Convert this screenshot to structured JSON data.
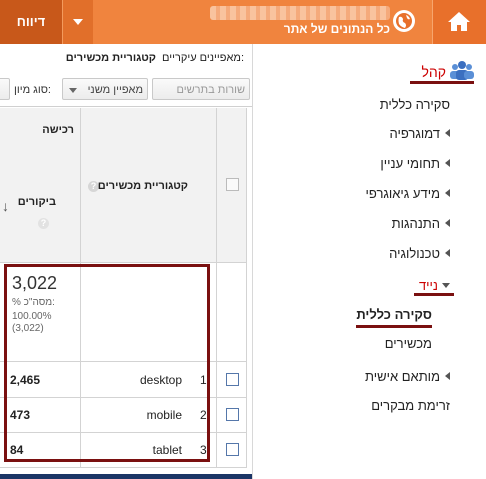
{
  "header": {
    "reports_label": "דיווח",
    "account_name": "כל הנתונים של אתר",
    "home_icon": "home-icon",
    "globe_icon": "globe-icon"
  },
  "sidebar": {
    "section_title": "קהל",
    "items": [
      {
        "label": "סקירה כללית"
      },
      {
        "label": "דמוגרפיה"
      },
      {
        "label": "תחומי עניין"
      },
      {
        "label": "מידע גיאוגרפי"
      },
      {
        "label": "התנהגות"
      },
      {
        "label": "טכנולוגיה"
      },
      {
        "label": "נייד"
      },
      {
        "label": "סקירה כללית"
      },
      {
        "label": "מכשירים"
      },
      {
        "label": "מותאם אישית"
      },
      {
        "label": "זרימת מבקרים"
      }
    ]
  },
  "content": {
    "primary_dimension_label": "מאפיינים עיקריים:",
    "primary_dimension_value": "קטגוריית מכשירים",
    "rows_button": "שורות בתרשים",
    "secondary_dimension": "מאפיין משני",
    "sort_label": "סוג מיון:"
  },
  "table": {
    "acquisition_header": "רכישה",
    "visits_header": "ביקורים",
    "category_header": "קטגוריית מכשירים",
    "totals": {
      "value": "3,022",
      "pct_label": "% מסה\"כ:",
      "pct": "100.00%",
      "abs": "(3,022)"
    },
    "rows": [
      {
        "index": "1.",
        "name": "desktop",
        "visits": "2,465"
      },
      {
        "index": "2.",
        "name": "mobile",
        "visits": "473"
      },
      {
        "index": "3.",
        "name": "tablet",
        "visits": "84"
      }
    ]
  },
  "colors": {
    "header_orange": "#f0843e",
    "reports_dark": "#c8581a",
    "highlight_red": "#7a1010",
    "audience_red": "#cc0000"
  }
}
